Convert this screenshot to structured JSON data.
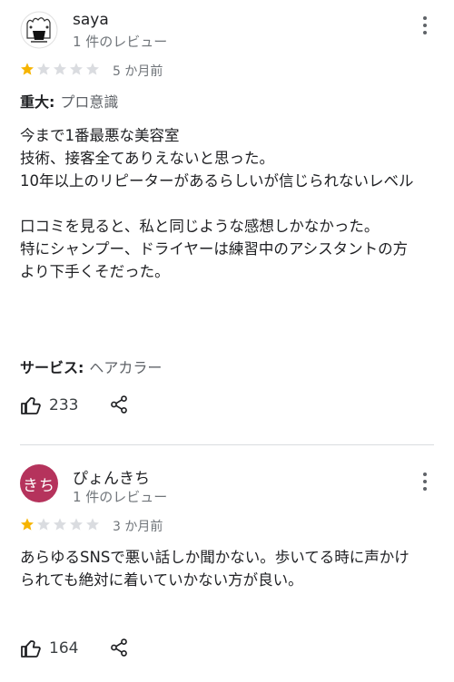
{
  "reviews": [
    {
      "author": "saya",
      "review_count": "1 件のレビュー",
      "rating": 1,
      "date": "5 か月前",
      "highlight_label": "重大:",
      "highlight_value": "プロ意識",
      "text": "今まで1番最悪な美容室\n技術、接客全てありえないと思った。\n10年以上のリピーターがあるらしいが信じられないレベル\n\n口コミを見ると、私と同じような感想しかなかった。\n特にシャンプー、ドライヤーは練習中のアシスタントの方より下手くそだった。",
      "service_label": "サービス:",
      "service_value": "ヘアカラー",
      "likes": "233"
    },
    {
      "author": "ぴょんきち",
      "avatar_initials": "きち",
      "avatar_color": "#b5335c",
      "review_count": "1 件のレビュー",
      "rating": 1,
      "date": "3 か月前",
      "text": "あらゆるSNSで悪い話しか聞かない。歩いてる時に声かけられても絶対に着いていかない方が良い。",
      "likes": "164"
    }
  ],
  "colors": {
    "star_filled": "#f6b400",
    "star_empty": "#dadce0"
  }
}
